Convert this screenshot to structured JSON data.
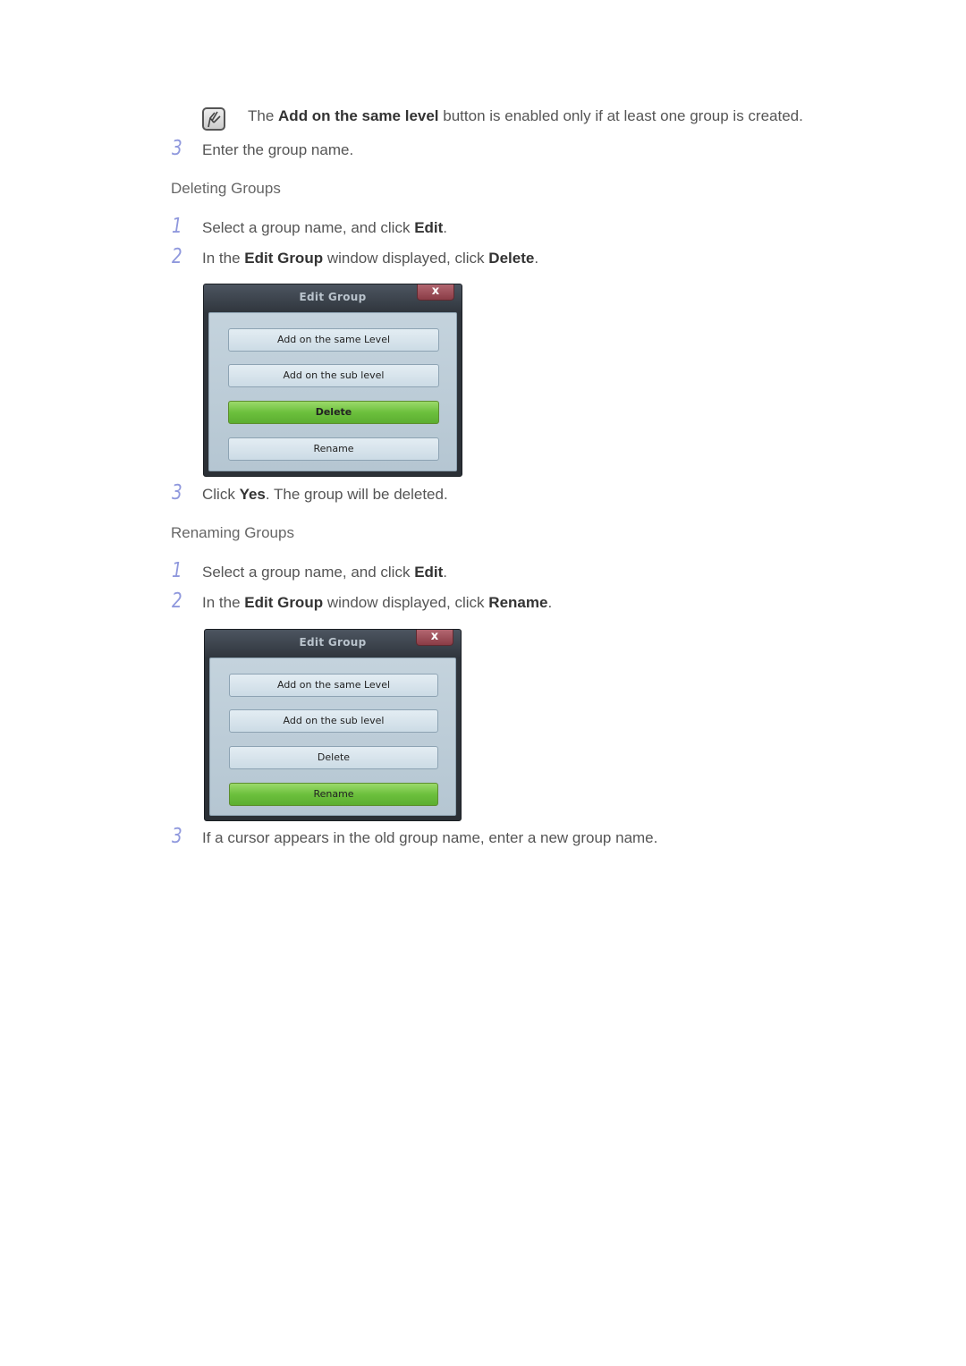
{
  "note": {
    "icon": "note-pencil-icon",
    "prefix": "The ",
    "bold": "Add on the same level",
    "suffix": " button is enabled only if at least one group is created."
  },
  "step_enter_name": {
    "num": "3",
    "text": "Enter the group name."
  },
  "deleting": {
    "heading": "Deleting Groups",
    "steps": [
      {
        "num": "1",
        "pre": "Select a group name, and click ",
        "bold": "Edit",
        "post": "."
      },
      {
        "num": "2",
        "pre": "In the ",
        "bold": "Edit Group",
        "mid": " window displayed, click ",
        "bold2": "Delete",
        "post": "."
      },
      {
        "num": "3",
        "pre": "Click ",
        "bold": "Yes",
        "post": ". The group will be deleted."
      }
    ],
    "dialog": {
      "title": "Edit Group",
      "close": "x",
      "buttons": [
        "Add on the same Level",
        "Add on the sub level",
        "Delete",
        "Rename"
      ],
      "active": "Delete"
    }
  },
  "renaming": {
    "heading": "Renaming Groups",
    "steps": [
      {
        "num": "1",
        "pre": "Select a group name, and click ",
        "bold": "Edit",
        "post": "."
      },
      {
        "num": "2",
        "pre": "In the ",
        "bold": "Edit Group",
        "mid": " window displayed, click ",
        "bold2": "Rename",
        "post": "."
      },
      {
        "num": "3",
        "pre": "If a cursor appears in the old group name, enter a new group name."
      }
    ],
    "dialog": {
      "title": "Edit Group",
      "close": "x",
      "buttons": [
        "Add on the same Level",
        "Add on the sub level",
        "Delete",
        "Rename"
      ],
      "active": "Rename"
    }
  }
}
